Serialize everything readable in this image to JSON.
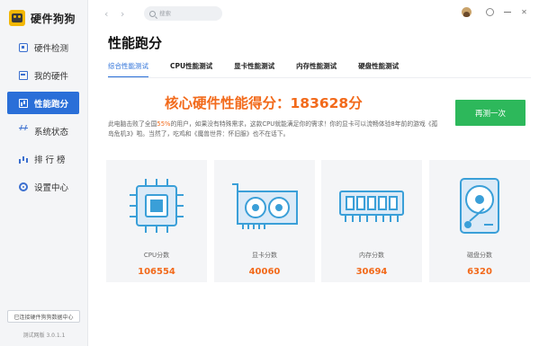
{
  "app": {
    "name": "硬件狗狗",
    "version": "测试网版 3.0.1.1",
    "data_center": "已连接硬件狗狗数据中心"
  },
  "sidebar": {
    "items": [
      {
        "label": "硬件检测",
        "icon": "cpu-chip-icon",
        "active": false
      },
      {
        "label": "我的硬件",
        "icon": "hardware-box-icon",
        "active": false
      },
      {
        "label": "性能跑分",
        "icon": "benchmark-chart-icon",
        "active": true
      },
      {
        "label": "系统状态",
        "icon": "pulse-icon",
        "active": false
      },
      {
        "label": "排 行 榜",
        "icon": "ranking-icon",
        "active": false
      },
      {
        "label": "设置中心",
        "icon": "gear-icon",
        "active": false
      }
    ]
  },
  "topbar": {
    "back": "‹",
    "forward": "›",
    "search_placeholder": "搜索",
    "close": "✕"
  },
  "main": {
    "title": "性能跑分",
    "tabs": [
      {
        "label": "综合性能测试",
        "active": true
      },
      {
        "label": "CPU性能测试",
        "active": false
      },
      {
        "label": "显卡性能测试",
        "active": false
      },
      {
        "label": "内存性能测试",
        "active": false
      },
      {
        "label": "硬盘性能测试",
        "active": false
      }
    ],
    "score_title": "核心硬件性能得分：183628分",
    "retest_label": "再测一次",
    "desc_prefix": "此电脑击败了全国",
    "desc_percent": "55%",
    "desc_suffix": "的用户，如果没有特殊需求，这款CPU就能满足你的需求！你的显卡可以流畅体验8年前的游戏《孤岛危机3》啦。当然了，吃鸡和《魔兽世界：怀旧服》也不在话下。"
  },
  "cards": [
    {
      "label": "CPU分数",
      "value": "106554",
      "icon": "cpu-icon"
    },
    {
      "label": "显卡分数",
      "value": "40060",
      "icon": "gpu-icon"
    },
    {
      "label": "内存分数",
      "value": "30694",
      "icon": "memory-icon"
    },
    {
      "label": "磁盘分数",
      "value": "6320",
      "icon": "disk-icon"
    }
  ],
  "colors": {
    "accent": "#2a6fd8",
    "score": "#f26a1b",
    "button_green": "#2db85b",
    "card_bg": "#f4f5f7",
    "illustration": "#3a9fd8"
  }
}
